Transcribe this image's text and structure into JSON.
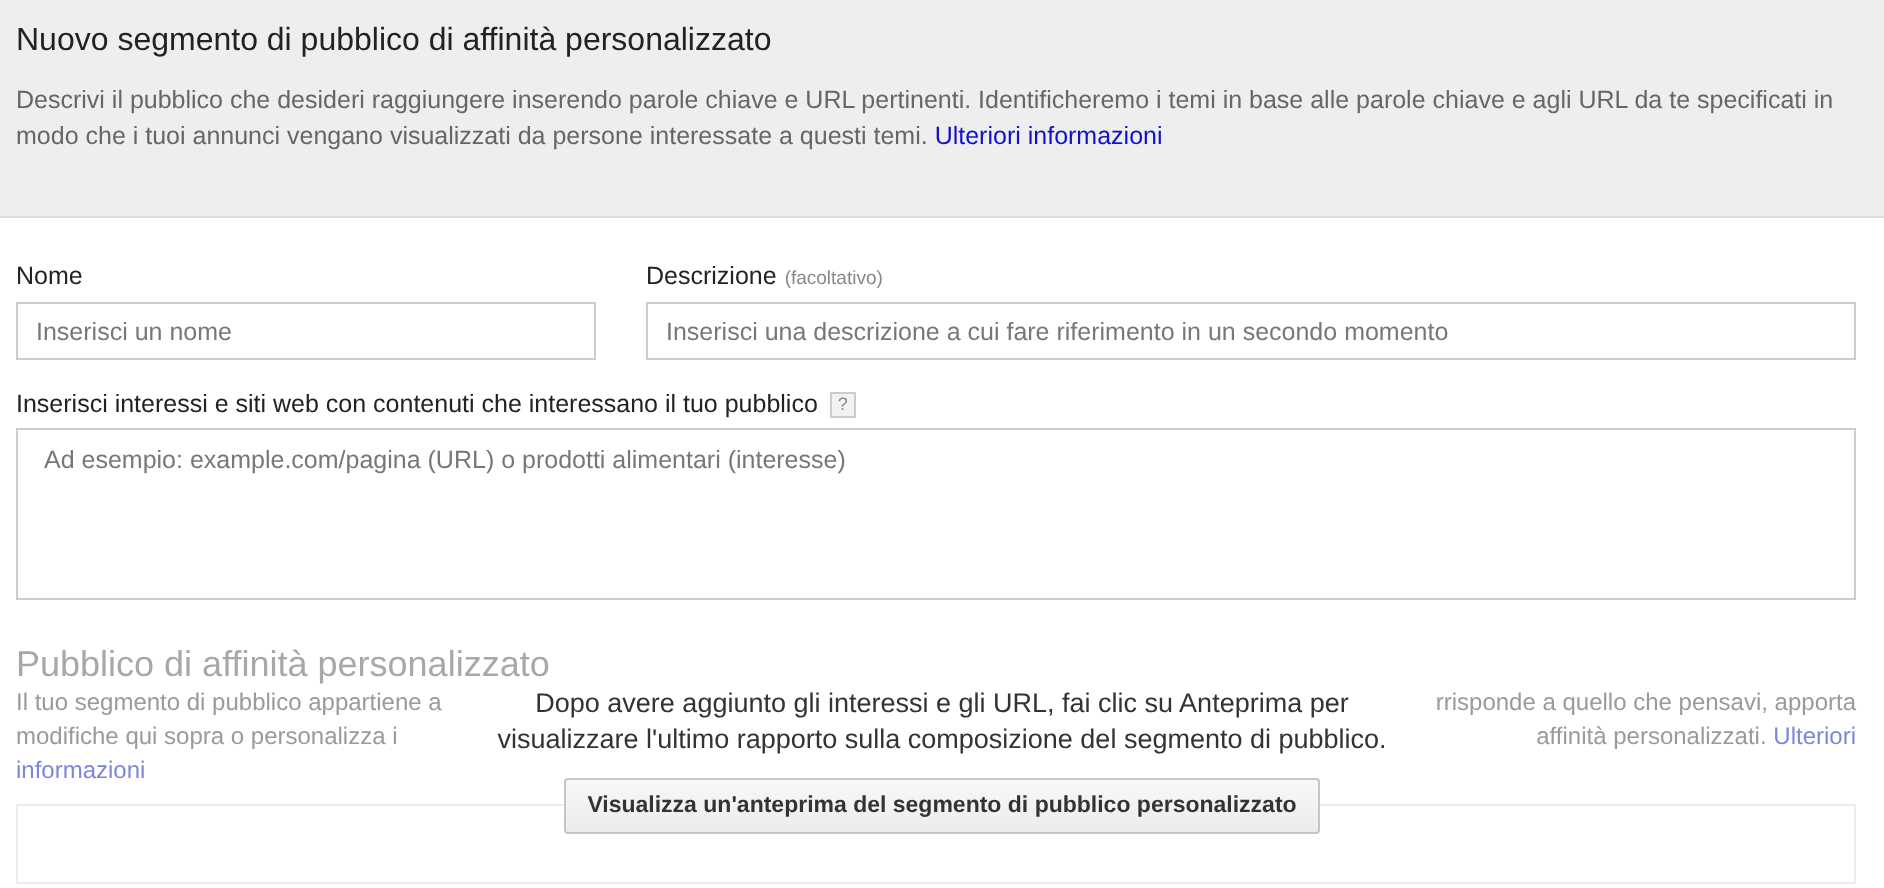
{
  "header": {
    "title": "Nuovo segmento di pubblico di affinità personalizzato",
    "description": "Descrivi il pubblico che desideri raggiungere inserendo parole chiave e URL pertinenti. Identificheremo i temi in base alle parole chiave e agli URL da te specificati in modo che i tuoi annunci vengano visualizzati da persone interessate a questi temi.",
    "link": "Ulteriori informazioni"
  },
  "name_field": {
    "label": "Nome",
    "placeholder": "Inserisci un nome"
  },
  "description_field": {
    "label": "Descrizione",
    "hint": "(facoltativo)",
    "placeholder": "Inserisci una descrizione a cui fare riferimento in un secondo momento"
  },
  "interests": {
    "label": "Inserisci interessi e siti web con contenuti che interessano il tuo pubblico",
    "help": "?",
    "placeholder": "Ad esempio: example.com/pagina (URL) o prodotti alimentari (interesse)"
  },
  "preview_section": {
    "title": "Pubblico di affinità personalizzato",
    "lines": [
      {
        "left": "Il tuo segmento di pubblico appartiene a",
        "right": "rrisponde a quello che pensavi, apporta"
      },
      {
        "left": "modifiche qui sopra o personalizza i",
        "right": "affinità personalizzati.",
        "link": "Ulteriori"
      },
      {
        "link": "informazioni"
      }
    ]
  },
  "overlay": {
    "message": "Dopo avere aggiunto gli interessi e gli URL, fai clic su Anteprima per visualizzare l'ultimo rapporto sulla composizione del segmento di pubblico.",
    "button": "Visualizza un'anteprima del segmento di pubblico personalizzato"
  }
}
